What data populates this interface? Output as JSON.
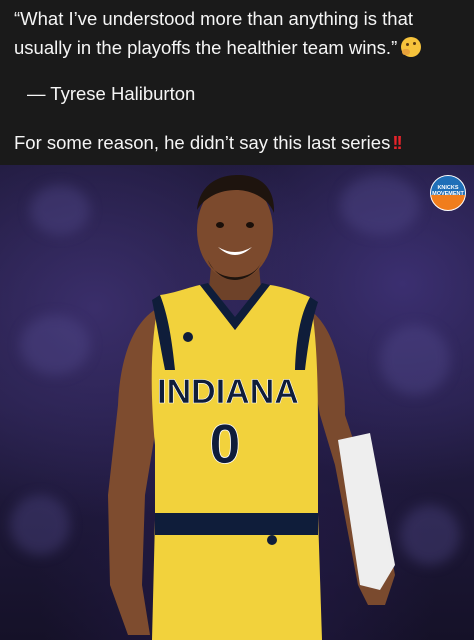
{
  "post": {
    "quote": "“What I’ve understood more than anything is that usually in the playoffs the healthier team wins.”",
    "quote_emoji": "thinking-face-emoji",
    "attribution": "— Tyrese Haliburton",
    "comment": "For some reason, he didn’t say this last series",
    "comment_emoji": "double-exclamation-emoji"
  },
  "image": {
    "logo_text_line1": "KNICKS",
    "logo_text_line2": "MOVEMENT",
    "jersey_team": "INDIANA",
    "jersey_number": "0"
  },
  "colors": {
    "background": "#1a1a1a",
    "jersey_yellow": "#f2d23c",
    "jersey_navy": "#0f1d3a",
    "logo_blue": "#1f6fb8",
    "logo_orange": "#f07d1c"
  }
}
